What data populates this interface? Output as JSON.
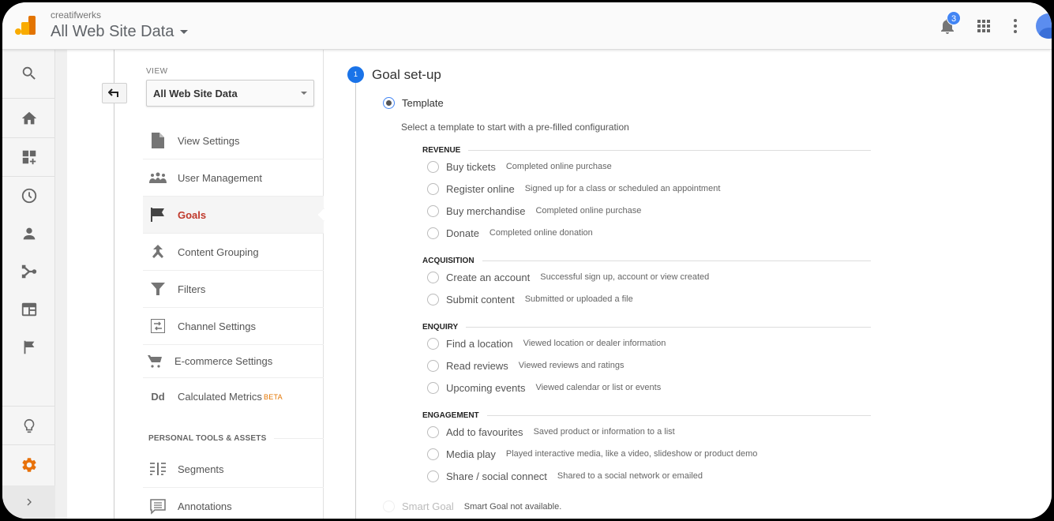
{
  "header": {
    "account": "creatifwerks",
    "property": "All Web Site Data",
    "notification_count": "3",
    "colors": {
      "logo_dark": "#e37400",
      "logo_light": "#f9ab00",
      "badge": "#4285f4"
    }
  },
  "rail": {
    "items": [
      {
        "icon": "search-icon"
      },
      {
        "icon": "home-icon"
      },
      {
        "icon": "customization-icon"
      },
      {
        "icon": "clock-icon"
      },
      {
        "icon": "person-icon"
      },
      {
        "icon": "acquisition-icon"
      },
      {
        "icon": "behavior-icon"
      },
      {
        "icon": "flag-icon"
      }
    ],
    "bottom": [
      {
        "icon": "lightbulb-icon"
      },
      {
        "icon": "gear-icon",
        "active": true,
        "color": "#e8710a"
      },
      {
        "icon": "chevron-right-icon"
      }
    ]
  },
  "admin": {
    "view_label": "VIEW",
    "view_selected": "All Web Site Data",
    "items": [
      {
        "label": "View Settings",
        "icon": "document-icon"
      },
      {
        "label": "User Management",
        "icon": "people-icon"
      },
      {
        "label": "Goals",
        "icon": "flag-icon",
        "active": true
      },
      {
        "label": "Content Grouping",
        "icon": "merge-icon"
      },
      {
        "label": "Filters",
        "icon": "filter-icon"
      },
      {
        "label": "Channel Settings",
        "icon": "channel-icon"
      },
      {
        "label": "E-commerce Settings",
        "icon": "cart-icon"
      },
      {
        "label": "Calculated Metrics",
        "icon": "calculated-icon",
        "badge": "BETA"
      }
    ],
    "section_title": "PERSONAL TOOLS & ASSETS",
    "tools": [
      {
        "label": "Segments",
        "icon": "segments-icon"
      },
      {
        "label": "Annotations",
        "icon": "annotation-icon"
      }
    ],
    "active_color": "#c0392b"
  },
  "main": {
    "step_number": "1",
    "step_title": "Goal set-up",
    "template_label": "Template",
    "template_selected": true,
    "template_desc": "Select a template to start with a pre-filled configuration",
    "categories": [
      {
        "title": "REVENUE",
        "options": [
          {
            "name": "Buy tickets",
            "desc": "Completed online purchase"
          },
          {
            "name": "Register online",
            "desc": "Signed up for a class or scheduled an appointment"
          },
          {
            "name": "Buy merchandise",
            "desc": "Completed online purchase"
          },
          {
            "name": "Donate",
            "desc": "Completed online donation"
          }
        ]
      },
      {
        "title": "ACQUISITION",
        "options": [
          {
            "name": "Create an account",
            "desc": "Successful sign up, account or view created"
          },
          {
            "name": "Submit content",
            "desc": "Submitted or uploaded a file"
          }
        ]
      },
      {
        "title": "ENQUIRY",
        "options": [
          {
            "name": "Find a location",
            "desc": "Viewed location or dealer information"
          },
          {
            "name": "Read reviews",
            "desc": "Viewed reviews and ratings"
          },
          {
            "name": "Upcoming events",
            "desc": "Viewed calendar or list or events"
          }
        ]
      },
      {
        "title": "ENGAGEMENT",
        "options": [
          {
            "name": "Add to favourites",
            "desc": "Saved product or information to a list"
          },
          {
            "name": "Media play",
            "desc": "Played interactive media, like a video, slideshow or product demo"
          },
          {
            "name": "Share / social connect",
            "desc": "Shared to a social network or emailed"
          }
        ]
      }
    ],
    "smart_goal": {
      "name": "Smart Goal",
      "desc": "Smart Goal not available."
    },
    "step_color": "#1a73e8"
  }
}
